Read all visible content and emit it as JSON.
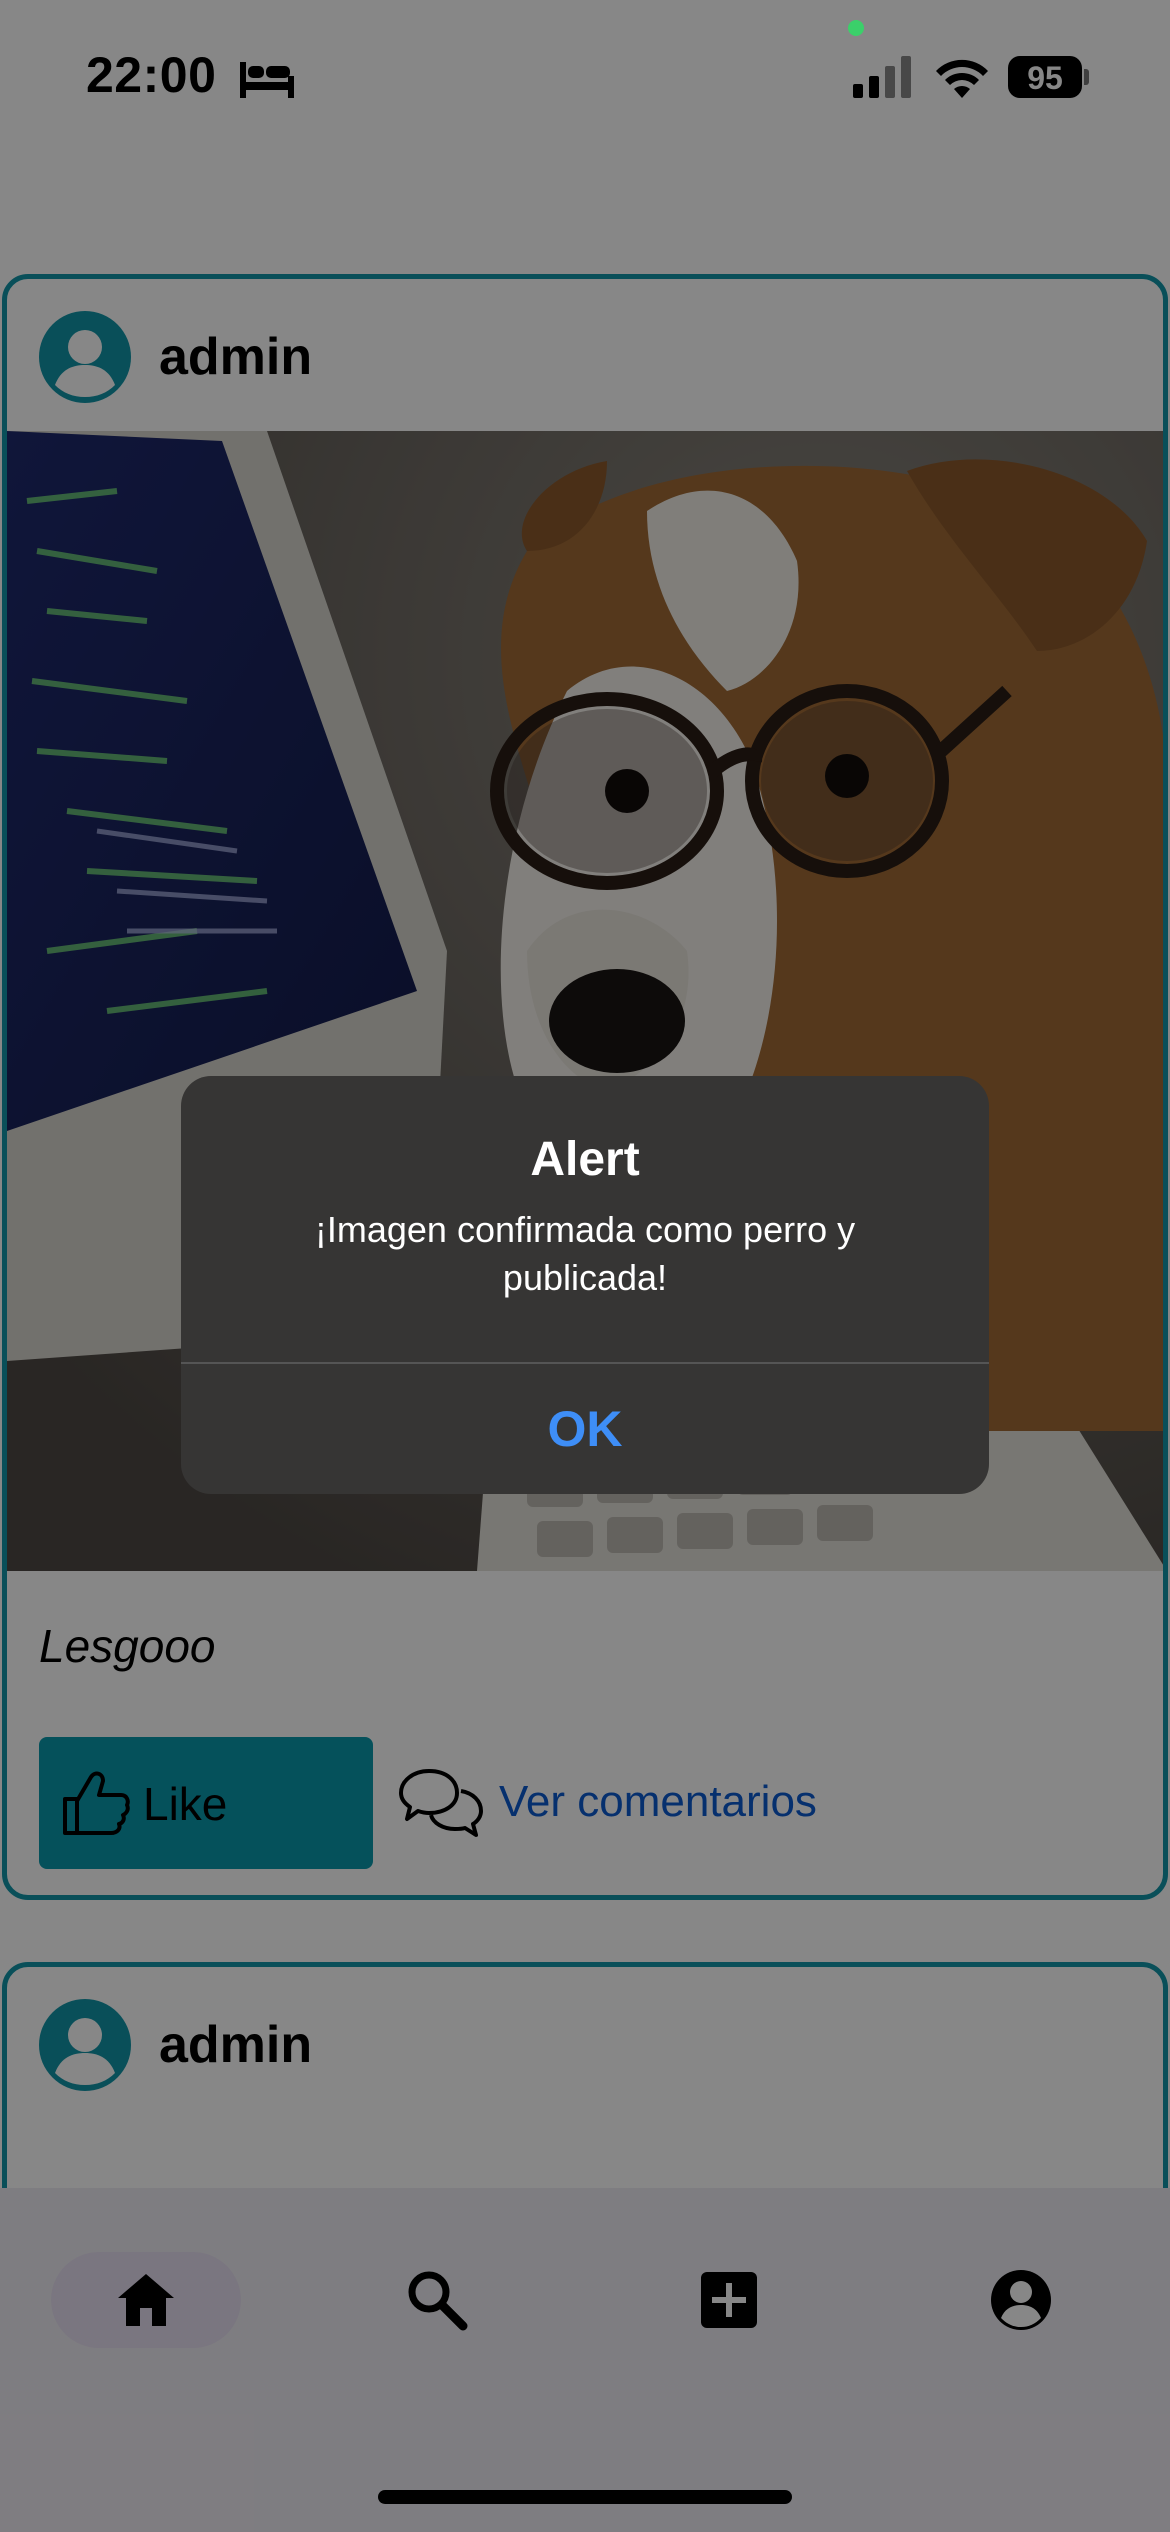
{
  "status_bar": {
    "time": "22:00",
    "focus_icon": "bed-icon",
    "battery": "95"
  },
  "feed": {
    "posts": [
      {
        "user": "admin",
        "avatar_icon": "user-circle-icon",
        "image_description_icon": "dog-at-computer-photo",
        "caption": "Lesgooo",
        "like_label": "Like",
        "comments_label": "Ver comentarios"
      },
      {
        "user": "admin",
        "avatar_icon": "user-circle-icon"
      }
    ]
  },
  "tab_bar": {
    "tabs": [
      {
        "name": "home",
        "icon": "home-icon",
        "active": true
      },
      {
        "name": "search",
        "icon": "search-icon",
        "active": false
      },
      {
        "name": "add",
        "icon": "add-box-icon",
        "active": false
      },
      {
        "name": "profile",
        "icon": "account-circle-icon",
        "active": false
      }
    ]
  },
  "alert": {
    "title": "Alert",
    "message": "¡Imagen confirmada como perro y publicada!",
    "ok_label": "OK"
  },
  "colors": {
    "accent": "#1196a8",
    "like_button": "#0b99ac",
    "link": "#0c5bd0",
    "alert_button": "#3e8ef7"
  }
}
